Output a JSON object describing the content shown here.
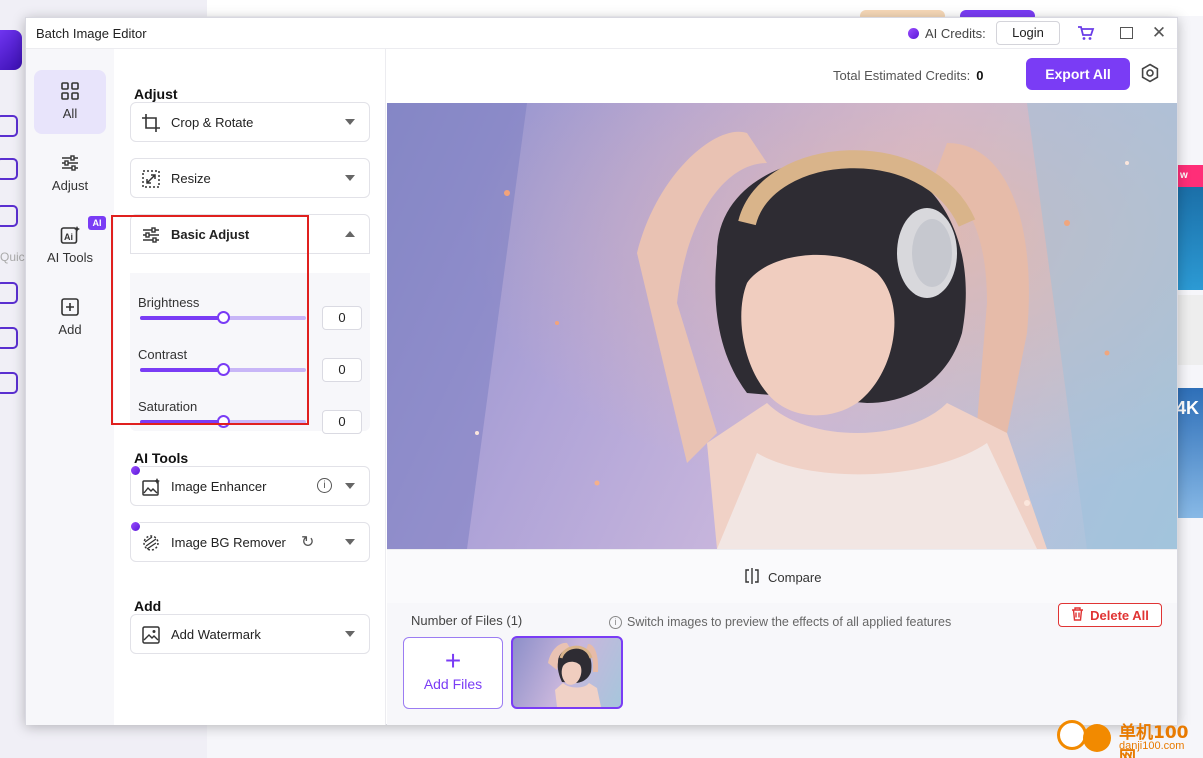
{
  "window": {
    "title": "Batch Image Editor",
    "ai_credits_label": "AI Credits:",
    "login_label": "Login"
  },
  "nav": {
    "items": [
      {
        "label": "All",
        "icon": "grid-icon"
      },
      {
        "label": "Adjust",
        "icon": "sliders-icon"
      },
      {
        "label": "AI Tools",
        "icon": "ai-icon",
        "badge": "AI"
      },
      {
        "label": "Add",
        "icon": "plus-square-icon"
      }
    ]
  },
  "panel": {
    "adjust_heading": "Adjust",
    "crop_rotate": "Crop & Rotate",
    "resize": "Resize",
    "basic_adjust": "Basic Adjust",
    "sliders": [
      {
        "label": "Brightness",
        "value": "0",
        "level": 0.5
      },
      {
        "label": "Contrast",
        "value": "0",
        "level": 0.5
      },
      {
        "label": "Saturation",
        "value": "0",
        "level": 0.5
      }
    ],
    "ai_tools_heading": "AI Tools",
    "image_enhancer": "Image Enhancer",
    "bg_remover": "Image BG Remover",
    "add_heading": "Add",
    "add_watermark": "Add Watermark"
  },
  "main": {
    "total_credits_label": "Total Estimated Credits:",
    "total_credits_value": "0",
    "export_all": "Export All",
    "compare": "Compare",
    "files_count": "Number of Files (1)",
    "switch_tip": "Switch images to preview the effects of all applied features",
    "delete_all": "Delete All",
    "add_files": "Add Files"
  },
  "background": {
    "quick_label": "Quic",
    "badge_w": "w",
    "badge_4k": "4K"
  },
  "watermark": {
    "line1": "单机100网",
    "line2": "danji100.com"
  },
  "colors": {
    "accent": "#7a3cf5",
    "highlight": "#e0201e",
    "danger": "#e03434"
  }
}
